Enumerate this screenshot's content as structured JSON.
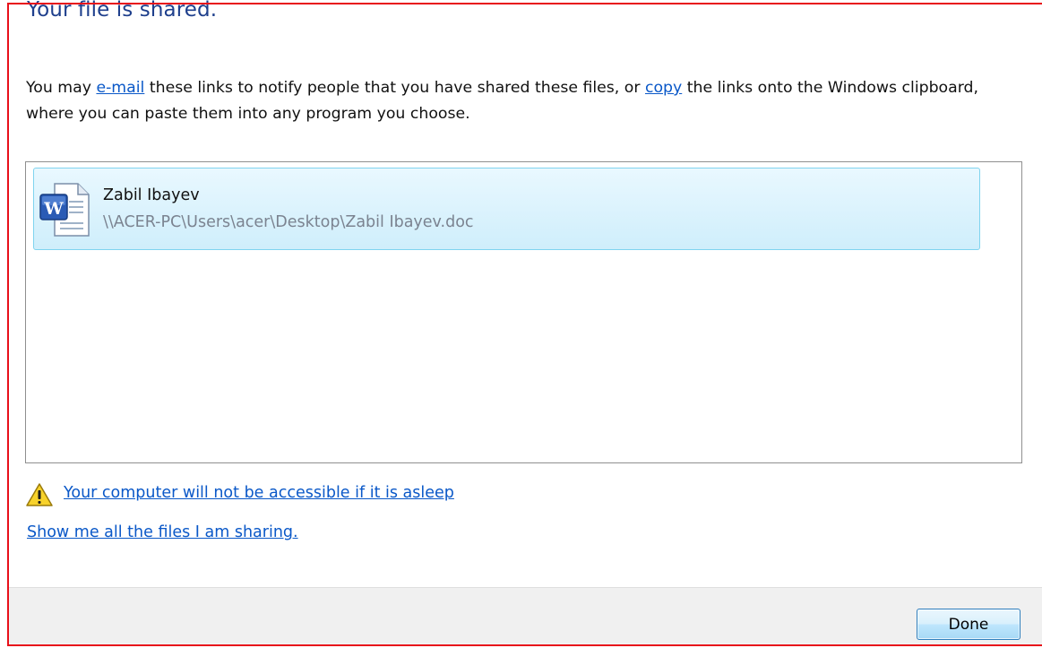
{
  "dialog": {
    "title": "Your file is shared.",
    "instructions": {
      "part1": "You may ",
      "email_link": "e-mail",
      "part2": " these links to notify people that you have shared these files, or ",
      "copy_link": "copy",
      "part3": " the links onto the Windows clipboard, where you can paste them into any program you choose."
    },
    "files": [
      {
        "name": "Zabil Ibayev",
        "path": "\\\\ACER-PC\\Users\\acer\\Desktop\\Zabil Ibayev.doc",
        "icon": "word-document-icon"
      }
    ],
    "warning_link": "Your computer will not be accessible if it is asleep",
    "show_files_link": "Show me all the files I am sharing.",
    "done_button": "Done"
  },
  "colors": {
    "title": "#1e3f8c",
    "link": "#0a58c8",
    "selection_border": "#7fd4ef",
    "selection_fill": "#cfeefb",
    "highlight_border": "#e8101a",
    "footer_bg": "#f0f0f0"
  }
}
